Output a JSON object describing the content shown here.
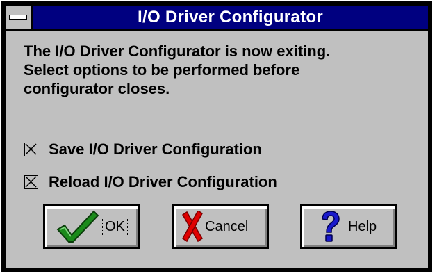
{
  "window": {
    "title": "I/O Driver Configurator",
    "system_menu_icon": "minus-bar-icon"
  },
  "message": {
    "lines": [
      "The I/O Driver Configurator is now exiting.",
      "Select options to be performed before",
      "configurator closes."
    ]
  },
  "options": [
    {
      "label": "Save I/O Driver Configuration",
      "checked": true
    },
    {
      "label": "Reload I/O Driver Configuration",
      "checked": true
    }
  ],
  "buttons": {
    "ok": {
      "label": "OK",
      "icon": "green-checkmark-icon"
    },
    "cancel": {
      "label": "Cancel",
      "icon": "red-x-icon"
    },
    "help": {
      "label": "Help",
      "icon": "blue-question-mark-icon"
    }
  },
  "colors": {
    "titlebar": "#000080",
    "dialog_face": "#c0c0c0",
    "ok_check": "#1a8a1a",
    "cancel_x": "#e00000",
    "help_mark": "#1a1acc"
  }
}
